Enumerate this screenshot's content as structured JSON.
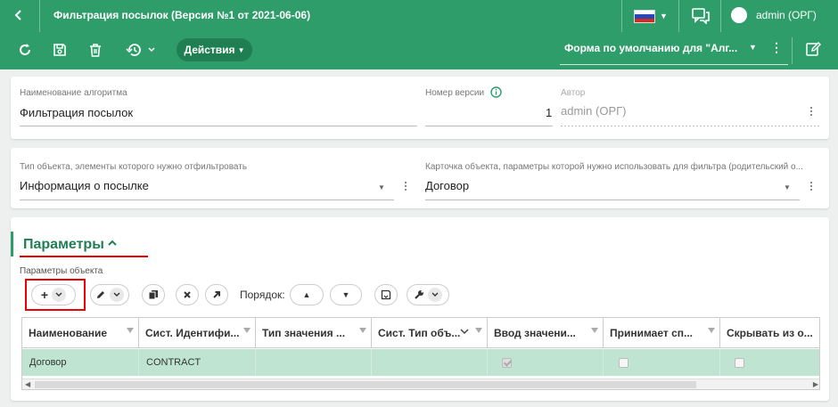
{
  "header": {
    "back_icon": "chevron-left-icon",
    "title": "Фильтрация посылок (Версия №1 от 2021-06-06)",
    "user_name": "admin (ОРГ)"
  },
  "toolbar": {
    "actions_label": "Действия",
    "form_selector": "Форма по умолчанию для \"Алг..."
  },
  "algorithm": {
    "name_label": "Наименование алгоритма",
    "name_value": "Фильтрация посылок",
    "version_label": "Номер версии",
    "version_value": "1",
    "author_label": "Автор",
    "author_value": "admin (ОРГ)"
  },
  "object": {
    "type_label": "Тип объекта, элементы которого нужно отфильтровать",
    "type_value": "Информация о посылке",
    "card_label": "Карточка объекта, параметры которой нужно использовать для фильтра (родительский о...",
    "card_value": "Договор"
  },
  "params": {
    "section_title": "Параметры",
    "object_params_label": "Параметры объекта",
    "order_label": "Порядок:",
    "columns": [
      "Наименование",
      "Сист. Идентифи...",
      "Тип значения ...",
      "Сист. Тип объ...",
      "Ввод значени...",
      "Принимает сп...",
      "Скрывать из о..."
    ],
    "rows": [
      {
        "name": "Договор",
        "sys_id": "CONTRACT",
        "value_type": "",
        "sys_obj_type": "",
        "input_value": true,
        "accepts": false,
        "hide": false
      }
    ]
  },
  "colors": {
    "accent": "#2e9d6a",
    "accent_dark": "#1f7f53",
    "row_selected": "#bfe5d2",
    "highlight": "#ee0000"
  }
}
